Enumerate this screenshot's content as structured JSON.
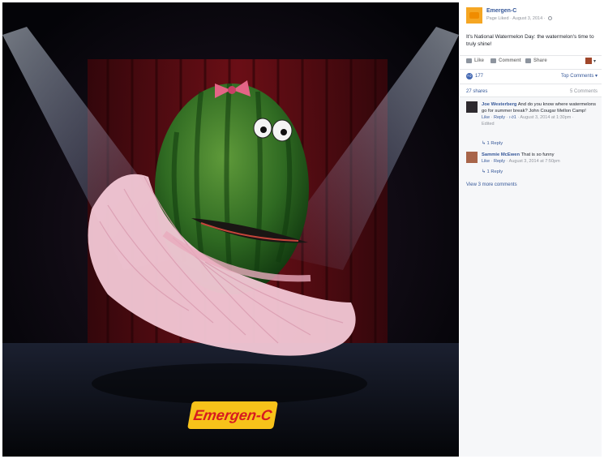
{
  "post": {
    "page_name": "Emergen-C",
    "meta_prefix": "Page Liked",
    "date": "August 3, 2014",
    "text": "It's National Watermelon Day: the watermelon's time to truly shine!",
    "brand_logo_text": "Emergen-C"
  },
  "actions": {
    "like": "Like",
    "comment": "Comment",
    "share": "Share",
    "viewer_caret": "▾"
  },
  "stats": {
    "likes": "177",
    "top_comments": "Top Comments ▾",
    "shares": "27 shares",
    "comments": "5 Comments"
  },
  "comments": [
    {
      "name": "Joe Westerberg",
      "text": "And do you know where watermelons go for summer break? John Cougar Mellon Camp!",
      "like": "Like",
      "reply": "Reply",
      "likes": "1",
      "time": "August 3, 2014 at 1:30pm",
      "edited": "Edited",
      "replies": "1 Reply",
      "avatar_color": "#2e2a2f"
    },
    {
      "name": "Sammie McEwen",
      "text": "That is so funny",
      "like": "Like",
      "reply": "Reply",
      "time": "August 3, 2014 at 7:50pm",
      "replies": "1 Reply",
      "avatar_color": "#a8654a"
    }
  ],
  "view_more": "View 3 more comments",
  "colors": {
    "link": "#365899",
    "accent": "#4267b2",
    "brand_yellow": "#f7c21a",
    "brand_red": "#d71920"
  }
}
